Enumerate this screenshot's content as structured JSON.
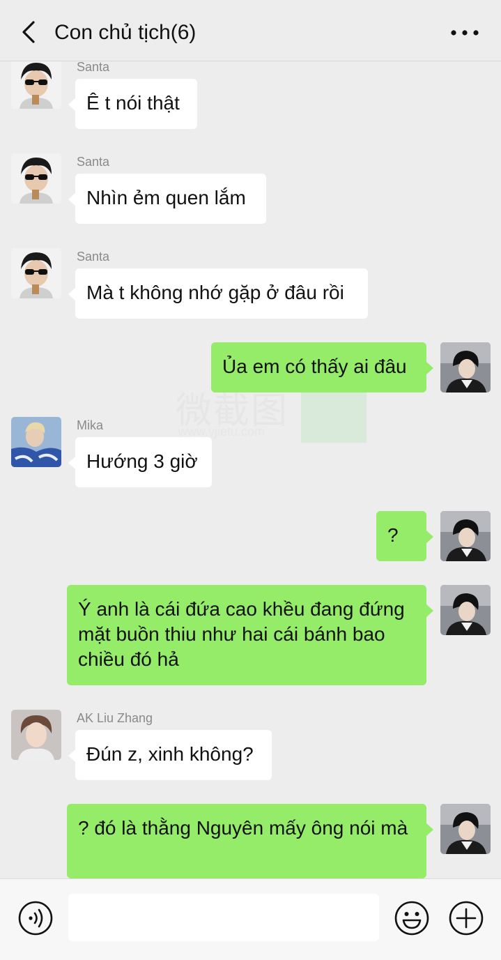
{
  "header": {
    "title": "Con chủ tịch(6)",
    "back_icon": "chevron-left-icon",
    "more_icon": "ellipsis-icon"
  },
  "watermark": {
    "text": "微截图",
    "url": "www.vjietu.com"
  },
  "messages": [
    {
      "side": "in",
      "sender": "Santa",
      "text": "Ê t nói thật"
    },
    {
      "side": "in",
      "sender": "Santa",
      "text": "Nhìn ẻm quen lắm"
    },
    {
      "side": "in",
      "sender": "Santa",
      "text": "Mà t không nhớ gặp ở đâu rồi"
    },
    {
      "side": "out",
      "text": "Ủa em có thấy ai đâu"
    },
    {
      "side": "in",
      "sender": "Mika",
      "text": "Hướng 3 giờ"
    },
    {
      "side": "out",
      "text": "?"
    },
    {
      "side": "out",
      "text": "Ý anh là cái đứa cao khều đang đứng mặt buồn thiu như hai cái bánh bao chiều đó hả"
    },
    {
      "side": "in",
      "sender": "AK Liu Zhang",
      "text": "Đún z, xinh không?"
    },
    {
      "side": "out",
      "text": "? đó là thằng Nguyên mấy ông nói mà"
    }
  ],
  "input_bar": {
    "voice_icon": "voice-icon",
    "input_placeholder": "",
    "emoji_icon": "emoji-icon",
    "plus_icon": "plus-icon"
  },
  "colors": {
    "background": "#ededed",
    "incoming_bubble": "#ffffff",
    "outgoing_bubble": "#95ec69",
    "sender_name": "#8a8a8a"
  }
}
